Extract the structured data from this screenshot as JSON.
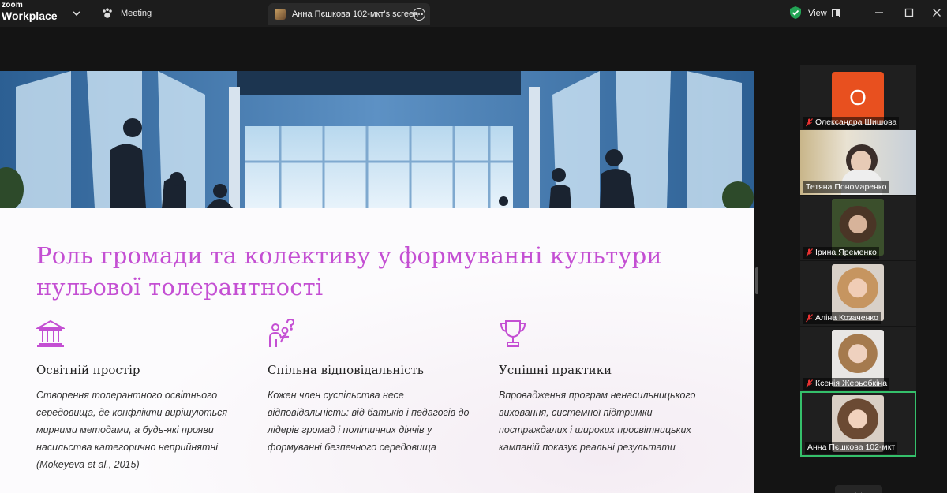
{
  "app": {
    "logo_line1": "zoom",
    "logo_line2": "Workplace"
  },
  "topbar": {
    "meeting_label": "Meeting",
    "share_label": "Анна Пєшкова 102-мкт's screen",
    "view_label": "View"
  },
  "colors": {
    "accent_green": "#35c06b",
    "title_magenta": "#c44fd3",
    "avatar_orange": "#e8501f"
  },
  "slide": {
    "title": "Роль громади та колективу у формуванні культури нульової толерантності",
    "columns": [
      {
        "icon": "university-icon",
        "heading": "Освітній простір",
        "text": "Створення толерантного освітнього середовища, де конфлікти вирішуються мирними методами, а будь-які прояви насильства категорично неприйнятні (Mokeyeva et al., 2015)"
      },
      {
        "icon": "people-question-icon",
        "heading": "Спільна відповідальність",
        "text": "Кожен член суспільства несе відповідальність: від батьків і педагогів до лідерів громад і політичних діячів у формуванні безпечного середовища"
      },
      {
        "icon": "trophy-icon",
        "heading": "Успішні практики",
        "text": "Впровадження програм ненасильницького виховання, системної підтримки постраждалих і широких просвітницьких кампаній показує реальні результати"
      }
    ]
  },
  "participants": [
    {
      "name": "Олександра Шишова",
      "initial": "О",
      "muted": true
    },
    {
      "name": "Тетяна Пономаренко",
      "muted": false
    },
    {
      "name": "Ірина Яременко",
      "muted": true
    },
    {
      "name": "Аліна Козаченко",
      "muted": true
    },
    {
      "name": "Ксенія Жерьобкіна",
      "muted": true
    },
    {
      "name": "Анна Пєшкова 102-мкт",
      "muted": false,
      "active": true
    }
  ]
}
